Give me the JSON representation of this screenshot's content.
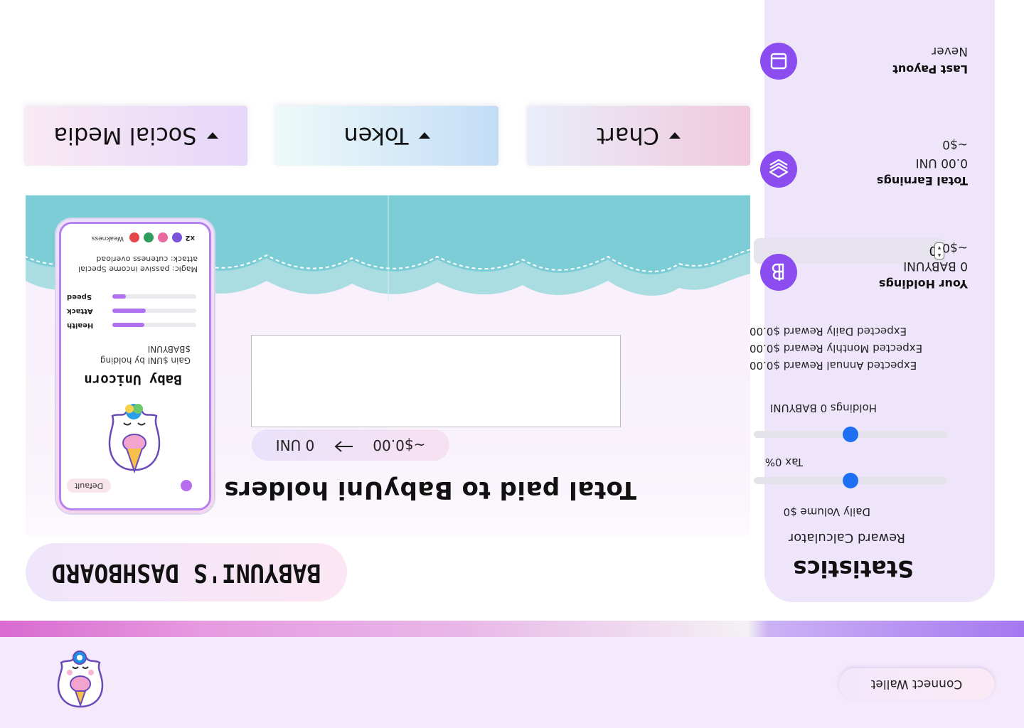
{
  "header": {
    "connect_wallet": "Connect Wallet"
  },
  "dashboard": {
    "title": "BABYUNI'S DASHBOARD",
    "total_title": "Total paid to BabyUni holders",
    "conversion": {
      "amount": "0 UNI",
      "usd": "~$0.00"
    }
  },
  "dropdowns": [
    {
      "label": "Social Media"
    },
    {
      "label": "Token"
    },
    {
      "label": "Chart"
    }
  ],
  "statistics": {
    "title": "Statistics",
    "subtitle": "Reward Calculator",
    "daily_volume_label": "Daily Volume $0",
    "daily_volume_level": 0.5,
    "tax_label": "Tax 0%",
    "tax_level": 0.5,
    "holdings_label": "Holdings 0 BABYUNI",
    "holdings_input": "0",
    "annual_reward": "Expected Annual Reward $0.00",
    "monthly_reward": "Expected Monthly Reward $0.00",
    "daily_reward": "Expected Daily Reward $0.00",
    "items": [
      {
        "label": "Your Holdings",
        "value": "0 BABYUNI",
        "sub": "~$0",
        "icon": "baht-icon"
      },
      {
        "label": "Total Earnings",
        "value": "0.00 UNI",
        "sub": "~$0",
        "icon": "layers-icon"
      },
      {
        "label": "Last Payout",
        "value": "Never",
        "sub": "",
        "icon": "panel-icon"
      }
    ]
  },
  "card": {
    "default_label": "Default",
    "name": "Baby Unicorn",
    "desc": "Gain $UNI by holding $BABYUNI",
    "stats": [
      {
        "label": "Health",
        "level": 0.38
      },
      {
        "label": "Attack",
        "level": 0.4
      },
      {
        "label": "Speed",
        "level": 0.16
      }
    ],
    "special": "Magic: passive income Special attack: cuteness overload",
    "weakness": "Weakness",
    "multiplier": "x2"
  },
  "colors": {
    "accent": "#8b4df0",
    "slider_knob": "#1f6ff2",
    "cloud": "#7ccdd6"
  }
}
